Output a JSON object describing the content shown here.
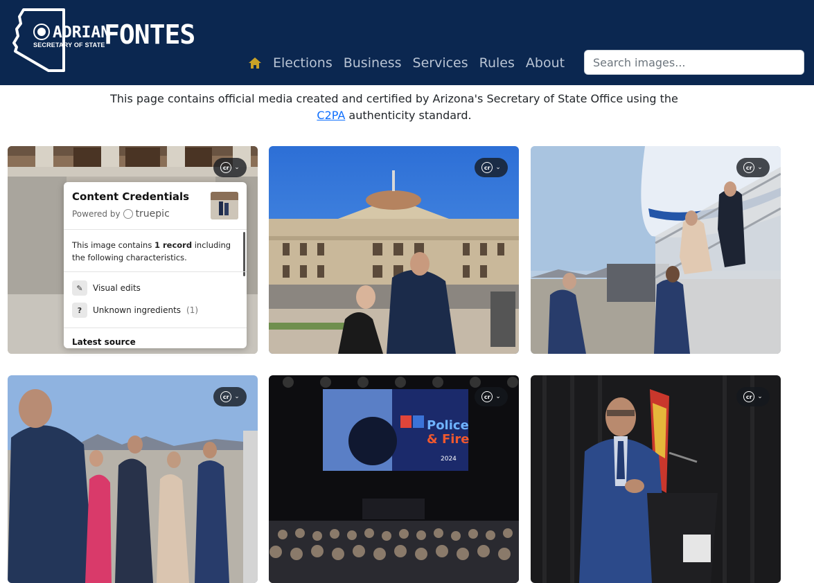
{
  "header": {
    "logo": {
      "first_name": "ADRIAN",
      "last_name": "FONTES",
      "subtitle": "SECRETARY OF STATE"
    },
    "nav": [
      "Elections",
      "Business",
      "Services",
      "Rules",
      "About"
    ],
    "search_placeholder": "Search images..."
  },
  "intro": {
    "text_before": "This page contains official media created and certified by Arizona's Secretary of State Office using the ",
    "link_text": "C2PA",
    "text_after": " authenticity standard."
  },
  "popover": {
    "title": "Content Credentials",
    "powered_by": "Powered by",
    "provider": "truepic",
    "desc_before": "This image contains ",
    "desc_bold": "1 record",
    "desc_after": " including the following characteristics.",
    "items": [
      {
        "label": "Visual edits",
        "count": ""
      },
      {
        "label": "Unknown ingredients",
        "count": "(1)"
      }
    ],
    "latest_source": "Latest source"
  },
  "colors": {
    "header_bg": "#0b2750",
    "link": "#0d6efd",
    "nav_text": "#b9c4d4",
    "home_icon": "#c9a227"
  }
}
